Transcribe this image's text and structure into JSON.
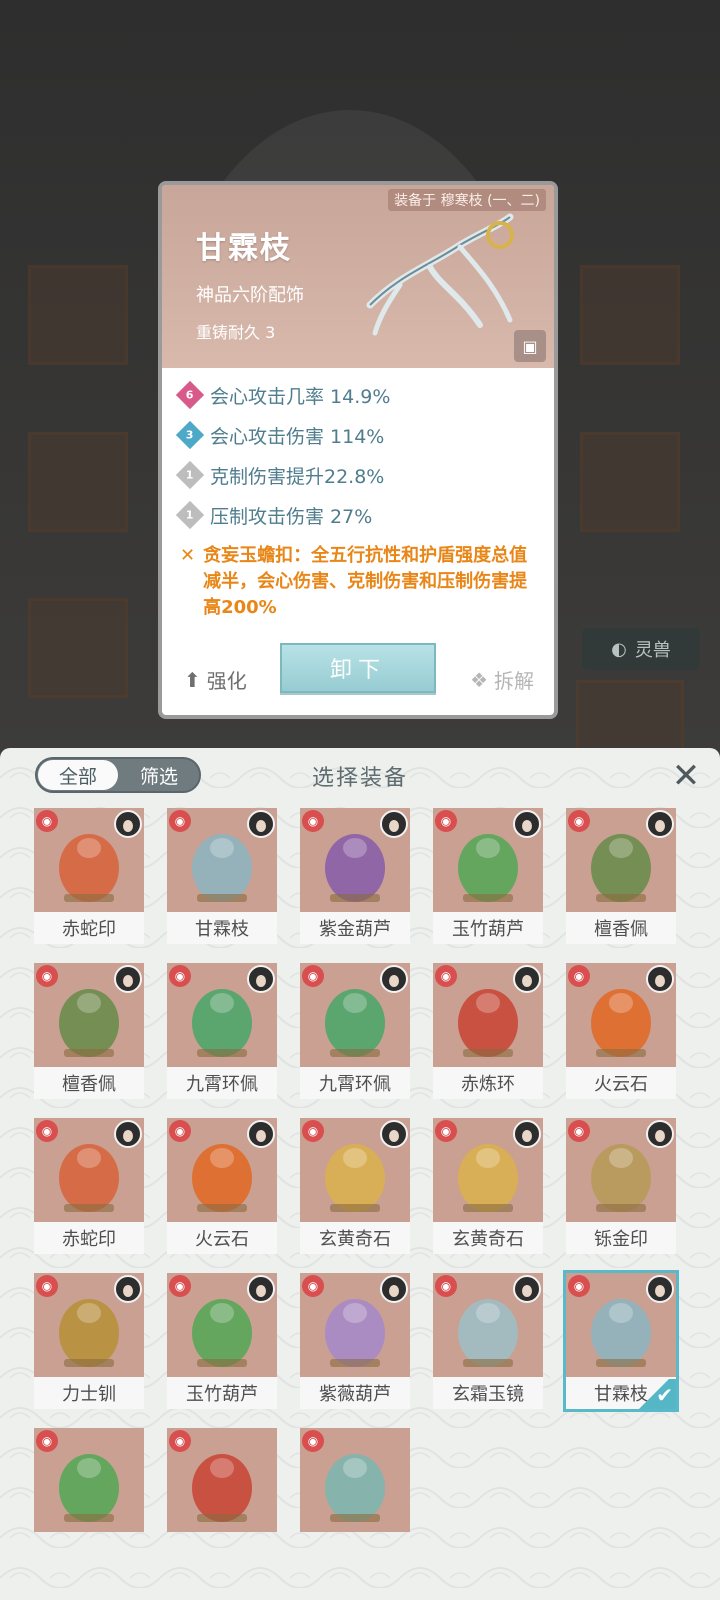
{
  "background": {
    "spirit_label": "灵兽"
  },
  "detail": {
    "equipped_on": "装备于 穆寒枝 (一、二)",
    "name": "甘霖枝",
    "grade": "神品六阶配饰",
    "reforge": "重铸耐久 3",
    "stats": [
      {
        "badge": "6",
        "color": "#d85a8a",
        "text": "会心攻击几率 14.9%"
      },
      {
        "badge": "3",
        "color": "#4ea9c8",
        "text": "会心攻击伤害 114%"
      },
      {
        "badge": "1",
        "color": "#bdbdbd",
        "text": "克制伤害提升22.8%"
      },
      {
        "badge": "1",
        "color": "#bdbdbd",
        "text": "压制攻击伤害 27%"
      }
    ],
    "special": "贪妄玉蟾扣：全五行抗性和护盾强度总值减半，会心伤害、克制伤害和压制伤害提高200%",
    "enhance_label": "强化",
    "unload_label": "卸下",
    "dismantle_label": "拆解"
  },
  "panel": {
    "title": "选择装备",
    "filter_all": "全部",
    "filter_select": "筛选",
    "items": [
      {
        "name": "赤蛇印",
        "color": "#d7663f"
      },
      {
        "name": "甘霖枝",
        "color": "#8fb4c0"
      },
      {
        "name": "紫金葫芦",
        "color": "#8a5fa8"
      },
      {
        "name": "玉竹葫芦",
        "color": "#5aa65a"
      },
      {
        "name": "檀香佩",
        "color": "#6b8c4c"
      },
      {
        "name": "檀香佩",
        "color": "#6b8c4c"
      },
      {
        "name": "九霄环佩",
        "color": "#4fa56a"
      },
      {
        "name": "九霄环佩",
        "color": "#4fa56a"
      },
      {
        "name": "赤炼环",
        "color": "#c9483a"
      },
      {
        "name": "火云石",
        "color": "#e06a2a"
      },
      {
        "name": "赤蛇印",
        "color": "#d7663f"
      },
      {
        "name": "火云石",
        "color": "#e06a2a"
      },
      {
        "name": "玄黄奇石",
        "color": "#d9b050"
      },
      {
        "name": "玄黄奇石",
        "color": "#d9b050"
      },
      {
        "name": "铄金印",
        "color": "#b89a5a"
      },
      {
        "name": "力士钏",
        "color": "#b8903c"
      },
      {
        "name": "玉竹葫芦",
        "color": "#5aa65a"
      },
      {
        "name": "紫薇葫芦",
        "color": "#a68ac8"
      },
      {
        "name": "玄霜玉镜",
        "color": "#9fbcc4"
      },
      {
        "name": "甘霖枝",
        "color": "#8fb4c0"
      },
      {
        "name": "",
        "color": "#5aa65a"
      },
      {
        "name": "",
        "color": "#c9483a"
      },
      {
        "name": "",
        "color": "#7fb5b0"
      }
    ],
    "selected_index": 19
  }
}
